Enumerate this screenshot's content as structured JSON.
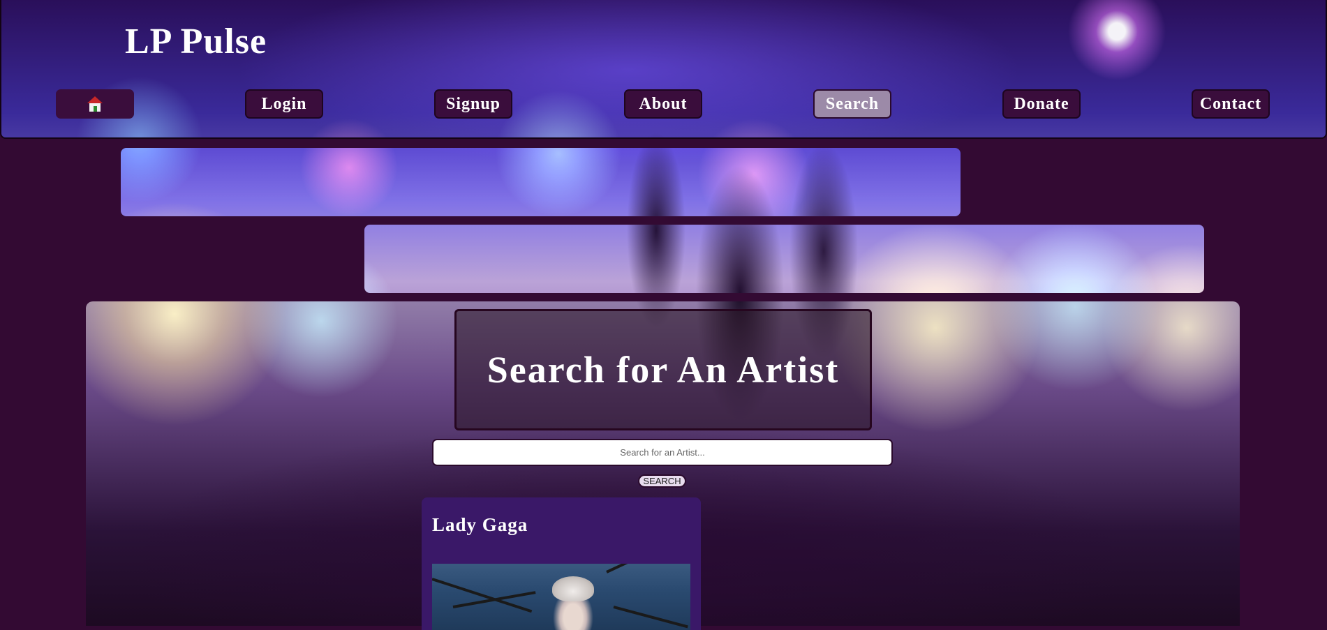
{
  "site": {
    "title": "LP Pulse"
  },
  "nav": {
    "home_icon": "home-icon",
    "items": [
      {
        "label": "Login"
      },
      {
        "label": "Signup"
      },
      {
        "label": "About"
      },
      {
        "label": "Search",
        "active": true
      },
      {
        "label": "Donate"
      },
      {
        "label": "Contact"
      }
    ]
  },
  "search": {
    "heading": "Search for An Artist",
    "placeholder": "Search for an Artist...",
    "button_label": "SEARCH"
  },
  "results": [
    {
      "name": "Lady Gaga"
    }
  ],
  "colors": {
    "page_background": "#330a33",
    "nav_button": "#3a0d3c",
    "nav_button_active": "#9c8aa8",
    "card_background": "#3a1868"
  }
}
